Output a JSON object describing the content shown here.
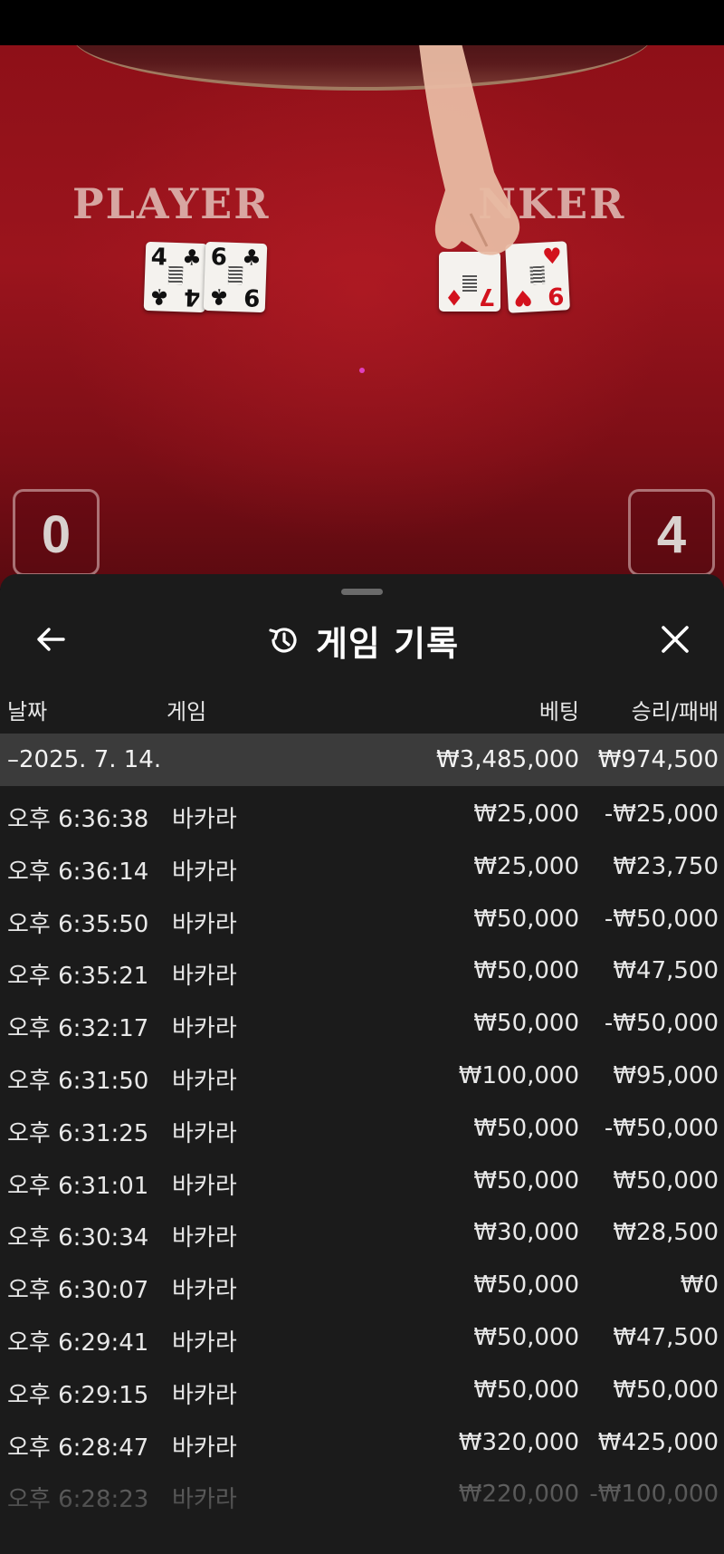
{
  "video": {
    "player_label": "PLAYER",
    "banker_label": "NKER",
    "player_score": "0",
    "banker_score": "4",
    "player_cards": [
      {
        "rank": "4",
        "suit": "♣",
        "rank_bottom": "4",
        "color": "black"
      },
      {
        "rank": "6",
        "suit": "♣",
        "rank_bottom": "9",
        "color": "black"
      }
    ],
    "banker_cards": [
      {
        "rank": "",
        "suit": "♦",
        "rank_bottom": "7",
        "color": "red"
      },
      {
        "rank": "",
        "suit": "♥",
        "rank_bottom": "9",
        "color": "red"
      }
    ]
  },
  "sheet": {
    "title": "게임 기록",
    "icons": {
      "back": "arrow-left-icon",
      "history": "history-icon",
      "close": "close-icon"
    },
    "columns": {
      "date": "날짜",
      "game": "게임",
      "bet": "베팅",
      "win_loss": "승리/패배"
    },
    "summary": {
      "date": "–2025. 7. 14.",
      "bet": "₩3,485,000",
      "win_loss": "₩974,500"
    },
    "rows": [
      {
        "time": "오후 6:36:38",
        "game": "바카라",
        "bet": "₩25,000",
        "win_loss": "-₩25,000"
      },
      {
        "time": "오후 6:36:14",
        "game": "바카라",
        "bet": "₩25,000",
        "win_loss": "₩23,750"
      },
      {
        "time": "오후 6:35:50",
        "game": "바카라",
        "bet": "₩50,000",
        "win_loss": "-₩50,000"
      },
      {
        "time": "오후 6:35:21",
        "game": "바카라",
        "bet": "₩50,000",
        "win_loss": "₩47,500"
      },
      {
        "time": "오후 6:32:17",
        "game": "바카라",
        "bet": "₩50,000",
        "win_loss": "-₩50,000"
      },
      {
        "time": "오후 6:31:50",
        "game": "바카라",
        "bet": "₩100,000",
        "win_loss": "₩95,000"
      },
      {
        "time": "오후 6:31:25",
        "game": "바카라",
        "bet": "₩50,000",
        "win_loss": "-₩50,000"
      },
      {
        "time": "오후 6:31:01",
        "game": "바카라",
        "bet": "₩50,000",
        "win_loss": "₩50,000"
      },
      {
        "time": "오후 6:30:34",
        "game": "바카라",
        "bet": "₩30,000",
        "win_loss": "₩28,500"
      },
      {
        "time": "오후 6:30:07",
        "game": "바카라",
        "bet": "₩50,000",
        "win_loss": "₩0"
      },
      {
        "time": "오후 6:29:41",
        "game": "바카라",
        "bet": "₩50,000",
        "win_loss": "₩47,500"
      },
      {
        "time": "오후 6:29:15",
        "game": "바카라",
        "bet": "₩50,000",
        "win_loss": "₩50,000"
      },
      {
        "time": "오후 6:28:47",
        "game": "바카라",
        "bet": "₩320,000",
        "win_loss": "₩425,000"
      },
      {
        "time": "오후 6:28:23",
        "game": "바카라",
        "bet": "₩220,000",
        "win_loss": "-₩100,000"
      }
    ]
  }
}
